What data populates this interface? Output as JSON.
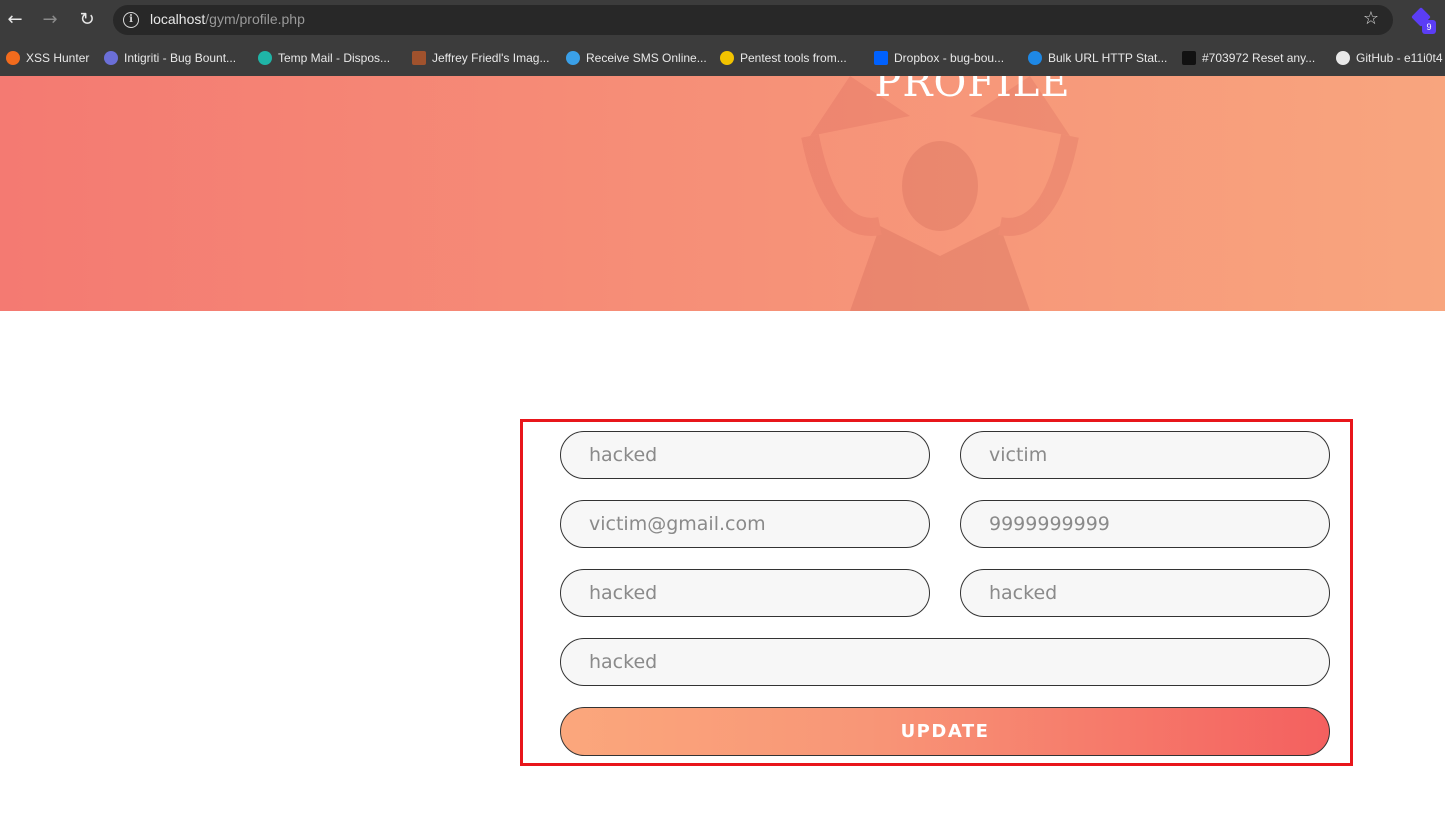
{
  "browser": {
    "url_host": "localhost",
    "url_path": "/gym/profile.php",
    "extension_badge": "9",
    "bookmarks": [
      {
        "label": "XSS Hunter",
        "color": "#f26b1d"
      },
      {
        "label": "Intigriti - Bug Bount...",
        "color": "#6b6fd8"
      },
      {
        "label": "Temp Mail - Dispos...",
        "color": "#1fb5a7"
      },
      {
        "label": "Jeffrey Friedl's Imag...",
        "color": "#a0522d"
      },
      {
        "label": "Receive SMS Online...",
        "color": "#3aa0e8"
      },
      {
        "label": "Pentest tools from...",
        "color": "#f2c300"
      },
      {
        "label": "Dropbox - bug-bou...",
        "color": "#0061fe"
      },
      {
        "label": "Bulk URL HTTP Stat...",
        "color": "#1e88e5"
      },
      {
        "label": "#703972 Reset any...",
        "color": "#111111"
      },
      {
        "label": "GitHub - e11i0t4",
        "color": "#e8e8e8"
      }
    ]
  },
  "hero": {
    "title": "PROFILE"
  },
  "form": {
    "first_name": "hacked",
    "last_name": "victim",
    "email": "victim@gmail.com",
    "phone": "9999999999",
    "field5": "hacked",
    "field6": "hacked",
    "field7": "hacked",
    "submit_label": "UPDATE"
  }
}
